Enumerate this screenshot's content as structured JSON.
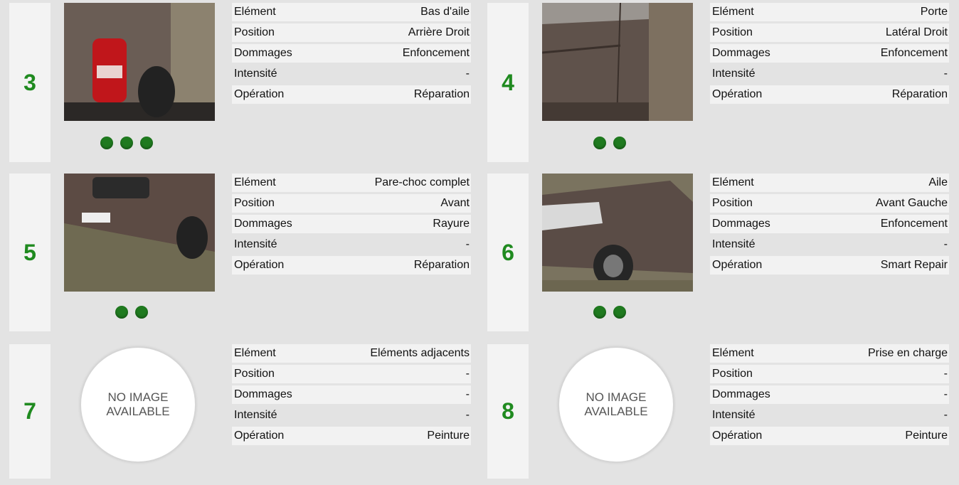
{
  "colors": {
    "accent_green": "#1f8a1f",
    "background": "#e3e3e3"
  },
  "cards": [
    {
      "number": "3",
      "image": "rear-tail-light-photo",
      "has_image": true,
      "dot_count": 3,
      "rows": [
        {
          "label": "Elément",
          "value": "Bas d'aile"
        },
        {
          "label": "Position",
          "value": "Arrière Droit"
        },
        {
          "label": "Dommages",
          "value": "Enfoncement"
        },
        {
          "label": "Intensité",
          "value": "-"
        },
        {
          "label": "Opération",
          "value": "Réparation"
        }
      ]
    },
    {
      "number": "4",
      "image": "side-door-photo",
      "has_image": true,
      "dot_count": 2,
      "rows": [
        {
          "label": "Elément",
          "value": "Porte"
        },
        {
          "label": "Position",
          "value": "Latéral Droit"
        },
        {
          "label": "Dommages",
          "value": "Enfoncement"
        },
        {
          "label": "Intensité",
          "value": "-"
        },
        {
          "label": "Opération",
          "value": "Réparation"
        }
      ]
    },
    {
      "number": "5",
      "image": "front-bumper-photo",
      "has_image": true,
      "dot_count": 2,
      "rows": [
        {
          "label": "Elément",
          "value": "Pare-choc complet"
        },
        {
          "label": "Position",
          "value": "Avant"
        },
        {
          "label": "Dommages",
          "value": "Rayure"
        },
        {
          "label": "Intensité",
          "value": "-"
        },
        {
          "label": "Opération",
          "value": "Réparation"
        }
      ]
    },
    {
      "number": "6",
      "image": "front-wing-photo",
      "has_image": true,
      "dot_count": 2,
      "rows": [
        {
          "label": "Elément",
          "value": "Aile"
        },
        {
          "label": "Position",
          "value": "Avant Gauche"
        },
        {
          "label": "Dommages",
          "value": "Enfoncement"
        },
        {
          "label": "Intensité",
          "value": "-"
        },
        {
          "label": "Opération",
          "value": "Smart Repair"
        }
      ]
    },
    {
      "number": "7",
      "has_image": false,
      "no_image_line1": "NO IMAGE",
      "no_image_line2": "AVAILABLE",
      "dot_count": 0,
      "rows": [
        {
          "label": "Elément",
          "value": "Eléments adjacents"
        },
        {
          "label": "Position",
          "value": "-"
        },
        {
          "label": "Dommages",
          "value": "-"
        },
        {
          "label": "Intensité",
          "value": "-"
        },
        {
          "label": "Opération",
          "value": "Peinture"
        }
      ]
    },
    {
      "number": "8",
      "has_image": false,
      "no_image_line1": "NO IMAGE",
      "no_image_line2": "AVAILABLE",
      "dot_count": 0,
      "rows": [
        {
          "label": "Elément",
          "value": "Prise en charge"
        },
        {
          "label": "Position",
          "value": "-"
        },
        {
          "label": "Dommages",
          "value": "-"
        },
        {
          "label": "Intensité",
          "value": "-"
        },
        {
          "label": "Opération",
          "value": "Peinture"
        }
      ]
    }
  ]
}
